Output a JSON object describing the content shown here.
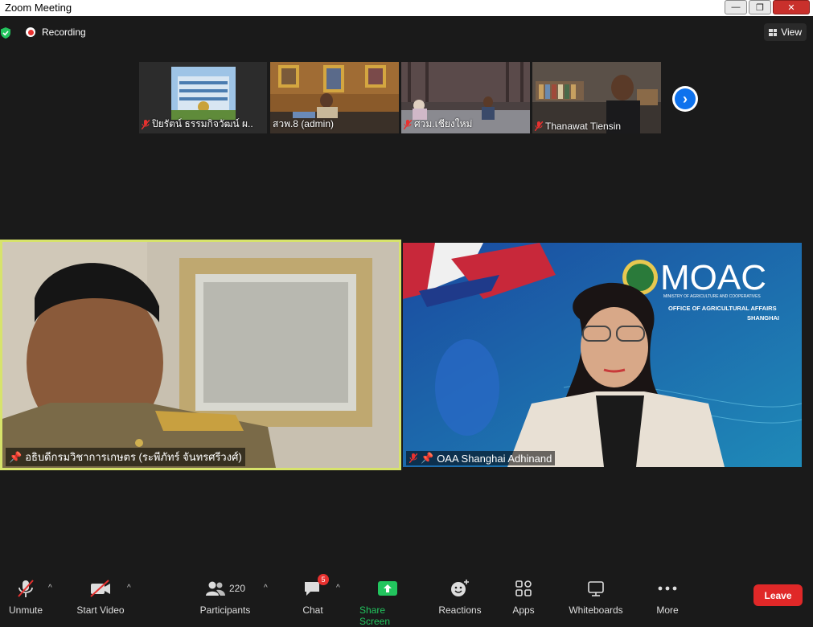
{
  "window": {
    "title": "Zoom Meeting"
  },
  "header": {
    "recording_label": "Recording",
    "view_label": "View"
  },
  "thumbnails": [
    {
      "name": "ปิยรัตน์ ธรรมกิจวัฒน์ ผ..",
      "muted": true
    },
    {
      "name": "สวพ.8 (admin)",
      "muted": false
    },
    {
      "name": "ศวม.เชียงใหม่",
      "muted": true
    },
    {
      "name": "Thanawat Tiensin",
      "muted": true
    }
  ],
  "main": {
    "left_name": "อธิบดีกรมวิชาการเกษตร (ระพีภัทร์ จันทรศรีวงศ์)",
    "right_name": "OAA Shanghai Adhinand",
    "moac": {
      "logo_text": "MOAC",
      "ministry": "MINISTRY OF AGRICULTURE AND COOPERATIVES",
      "office": "OFFICE OF AGRICULTURAL AFFAIRS",
      "city": "SHANGHAI"
    }
  },
  "toolbar": {
    "unmute": "Unmute",
    "start_video": "Start Video",
    "participants": "Participants",
    "participants_count": "220",
    "chat": "Chat",
    "chat_badge": "5",
    "share_screen": "Share Screen",
    "reactions": "Reactions",
    "apps": "Apps",
    "whiteboards": "Whiteboards",
    "more": "More",
    "leave": "Leave"
  },
  "colors": {
    "share_green": "#22c55e",
    "leave_red": "#e02828",
    "badge_red": "#e8312f",
    "active_speaker_border": "#d7e36b",
    "accent_blue": "#0e72ed"
  }
}
